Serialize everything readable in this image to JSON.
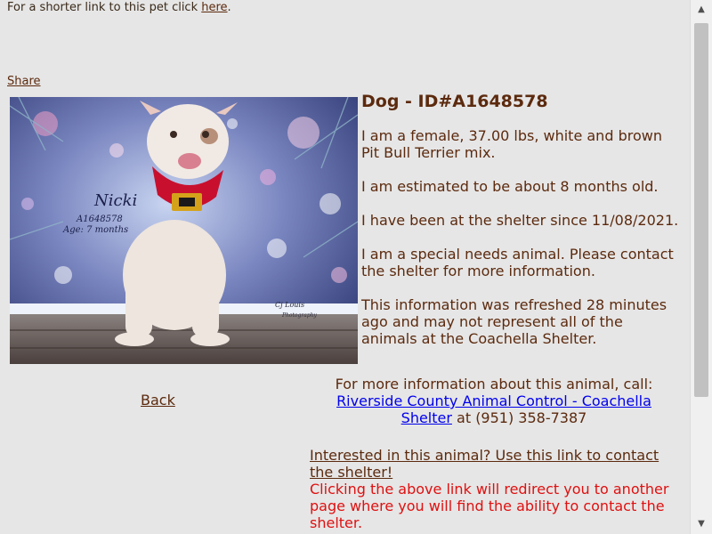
{
  "short_link": {
    "prefix": "For a shorter link to this pet click ",
    "link_label": "here",
    "suffix": "."
  },
  "share_label": "Share",
  "photo": {
    "overlay_name": "Nicki",
    "overlay_id": "A1648578",
    "overlay_age": "Age: 7 months",
    "watermark_line1": "Cj Louis",
    "watermark_line2": "Photography"
  },
  "pet": {
    "title": "Dog - ID#A1648578",
    "description": "I am a female, 37.00 lbs, white and brown Pit Bull Terrier mix.",
    "age": "I am estimated to be about 8 months old.",
    "shelter_since": "I have been at the shelter since 11/08/2021.",
    "special_needs": "I am a special needs animal. Please contact the shelter for more information.",
    "refresh_note": "This information was refreshed 28 minutes ago and may not represent all of the animals at the Coachella Shelter."
  },
  "back_label": "Back",
  "more_info": {
    "prefix": "For more information about this animal, call:",
    "shelter_link": "Riverside County Animal Control - Coachella Shelter",
    "phone": " at (951) 358-7387"
  },
  "contact": {
    "link_label": "Interested in this animal? Use this link to contact the shelter!",
    "redirect_note": "Clicking the above link will redirect you to another page where you will find the ability to contact the shelter."
  },
  "colors": {
    "page_bg": "#e6e6e6",
    "text_brown": "#5c2a0e",
    "warning_red": "#e01010"
  }
}
